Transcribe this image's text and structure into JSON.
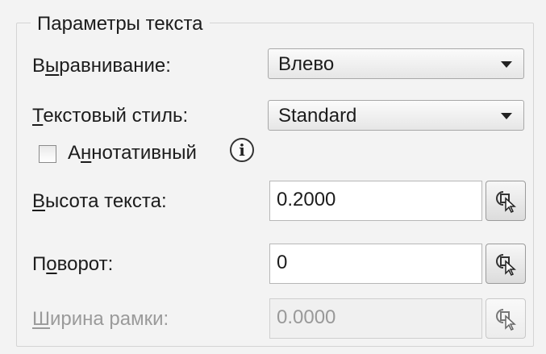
{
  "group": {
    "title": "Параметры текста"
  },
  "alignment": {
    "label_pre": "В",
    "label_mn": "ы",
    "label_post": "равнивание:",
    "value": "Влево",
    "arrow_icon": "chevron-down-icon"
  },
  "text_style": {
    "label_pre": "",
    "label_mn": "Т",
    "label_post": "екстовый стиль:",
    "value": "Standard",
    "arrow_icon": "chevron-down-icon"
  },
  "annotative": {
    "label_pre": "А",
    "label_mn": "н",
    "label_post": "нотативный",
    "checked": false,
    "info_icon": "info-icon",
    "info_glyph": "i"
  },
  "text_height": {
    "label_pre": "",
    "label_mn": "В",
    "label_post": "ысота текста:",
    "value": "0.2000",
    "pick_icon": "pick-point-icon"
  },
  "rotation": {
    "label_pre": "П",
    "label_mn": "о",
    "label_post": "ворот:",
    "value": "0",
    "pick_icon": "pick-point-icon"
  },
  "frame_width": {
    "label_pre": "",
    "label_mn": "Ш",
    "label_post": "ирина рамки:",
    "value": "0.0000",
    "pick_icon": "pick-point-icon",
    "disabled": true
  }
}
